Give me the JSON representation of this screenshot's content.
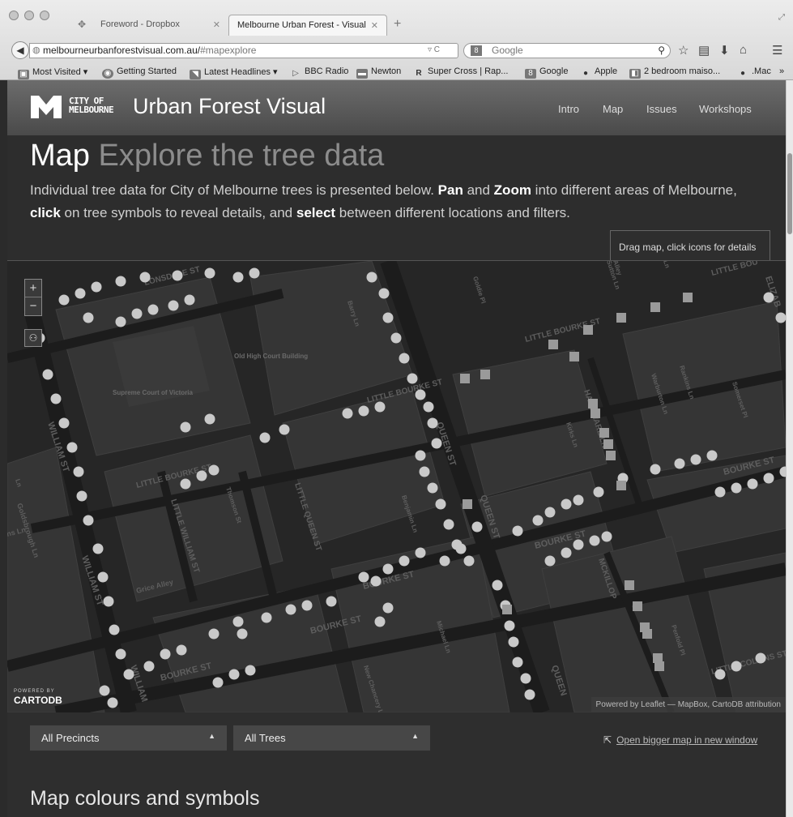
{
  "browser": {
    "tabs": [
      {
        "title": "Foreword - Dropbox",
        "icon": "dropbox-icon"
      },
      {
        "title": "Melbourne Urban Forest - Visual",
        "icon": "page-icon"
      }
    ],
    "url": {
      "host": "melbourneurbanforestvisual.com.au/",
      "hash": "#mapexplore"
    },
    "search_placeholder": "Google",
    "bookmarks": [
      "Most Visited ▾",
      "Getting Started",
      "Latest Headlines ▾",
      "BBC Radio",
      "Newton",
      "Super Cross | Rap...",
      "Google",
      "Apple",
      "2 bedroom maiso...",
      ".Mac",
      "»"
    ]
  },
  "site": {
    "logo_line1": "CITY OF",
    "logo_line2": "MELBOURNE",
    "title": "Urban Forest Visual",
    "nav": [
      "Intro",
      "Map",
      "Issues",
      "Workshops"
    ]
  },
  "section": {
    "heading": "Map",
    "heading_sub": "Explore the tree data",
    "intro": {
      "t1": "Individual tree data for City of Melbourne trees is presented below. ",
      "b1": "Pan",
      "t2": " and ",
      "b2": "Zoom",
      "t3": " into different areas of Melbourne, ",
      "b3": "click",
      "t4": " on tree symbols to reveal details, and ",
      "b4": "select",
      "t5": " between different locations and filters."
    },
    "tooltip": "Drag map, click icons for details"
  },
  "map": {
    "streets": [
      "LONSDALE ST",
      "LITTLE BOURKE ST",
      "LITTLE BOURKE ST",
      "LITTLE BOURKE ST",
      "BOURKE ST",
      "BOURKE ST",
      "BOURKE ST",
      "BOURKE ST",
      "BOURKE ST",
      "WILLIAM ST",
      "WILLIAM ST",
      "WILLIAM",
      "QUEEN ST",
      "QUEEN ST",
      "QUEEN",
      "LITTLE QUEEN ST",
      "LITTLE WILLIAM ST",
      "LITTLE COLLINS ST",
      "ELIZAB",
      "LITTLE BOU",
      "HARDWARE LN",
      "MCKILLOP",
      "Goldsbrough Ln",
      "Grice Alley",
      "Thomson St",
      "Benjamin Ln",
      "Michael Ln",
      "New Chancery Ln",
      "Kirks Ln",
      "Warburton Ln",
      "Rankins Ln",
      "Somerset Pl",
      "Barry Ln",
      "Goldie Pl",
      "Penfold Pl",
      "Sutton Ln",
      "Alley",
      "Ln",
      "Ln",
      "ns Ln",
      "ST"
    ],
    "places": [
      "Supreme Court of Victoria",
      "Old High Court Building"
    ],
    "zoom_in": "+",
    "zoom_out": "−",
    "powered_by": "POWERED BY",
    "cartodb": "CARTODB",
    "attribution": "Powered by Leaflet — MapBox, CartoDB attribution",
    "colors": {
      "tree_dot": "#c9c9c9",
      "block": "#353535",
      "road": "#1c1c1c"
    }
  },
  "filters": {
    "precinct": "All Precincts",
    "trees": "All Trees",
    "open_link": "Open bigger map in new window"
  },
  "legend_heading": "Map colours and symbols"
}
